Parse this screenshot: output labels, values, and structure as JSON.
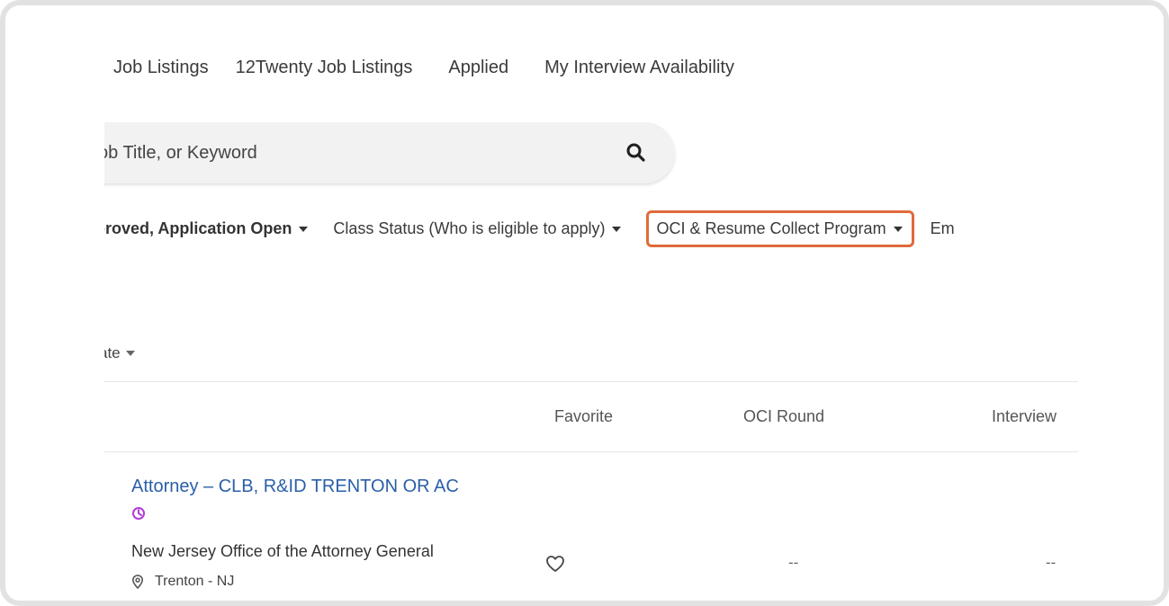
{
  "nav": {
    "tabs": [
      {
        "label": "Job Listings"
      },
      {
        "label": "12Twenty Job Listings"
      },
      {
        "label": "Applied"
      },
      {
        "label": "My Interview Availability"
      }
    ]
  },
  "search": {
    "placeholder": "ob Title, or Keyword",
    "icon": "search-icon"
  },
  "filters": [
    {
      "label": "proved, Application Open"
    },
    {
      "label": "Class Status (Who is eligible to apply)"
    },
    {
      "label": "OCI & Resume Collect Program",
      "highlight_color": "#e06a3b"
    },
    {
      "label": "Em"
    }
  ],
  "sort": {
    "label": "ate"
  },
  "table": {
    "headers": [
      "Favorite",
      "OCI Round",
      "Interview"
    ],
    "rows": [
      {
        "title": "Attorney – CLB, R&ID TRENTON OR AC",
        "employer": "New Jersey Office of the Attorney General",
        "location": "Trenton - NJ",
        "favorite_icon": "heart-outline-icon",
        "oci_round": "--",
        "interview": "--"
      }
    ]
  },
  "colors": {
    "link": "#2a5fa8",
    "badge": "#b23bd6"
  }
}
